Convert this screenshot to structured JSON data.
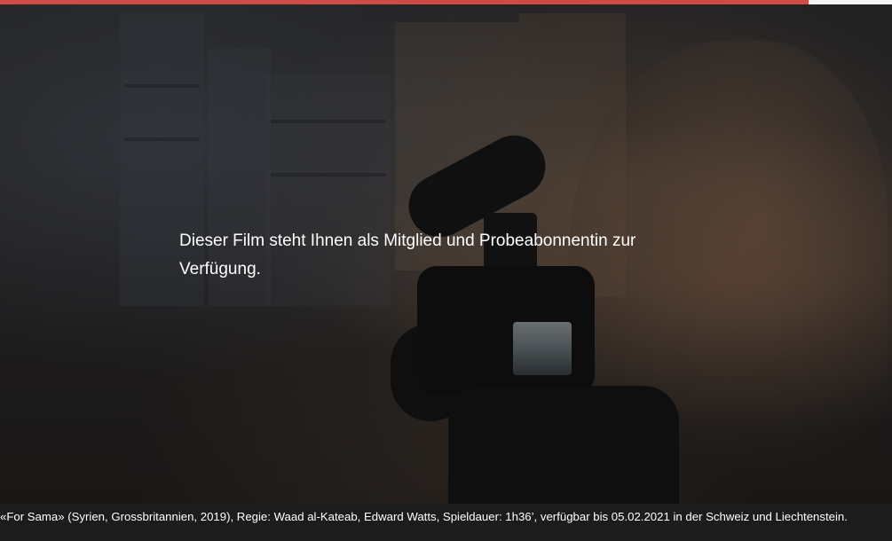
{
  "player": {
    "progress_fraction": 0.906,
    "progress_color": "#cf4b45",
    "track_color": "#f4f4f4",
    "availability_message": "Dieser Film steht Ihnen als Mitglied und Probeabonnentin zur Verfügung."
  },
  "caption": {
    "text": "«For Sama» (Syrien, Grossbritannien, 2019), Regie: Waad al-Kateab, Edward Watts, Spieldauer: 1h36’, verfügbar bis 05.02.2021 in der Schweiz und Liechtenstein."
  },
  "video": {
    "still_description_icon": "camera-icon"
  }
}
